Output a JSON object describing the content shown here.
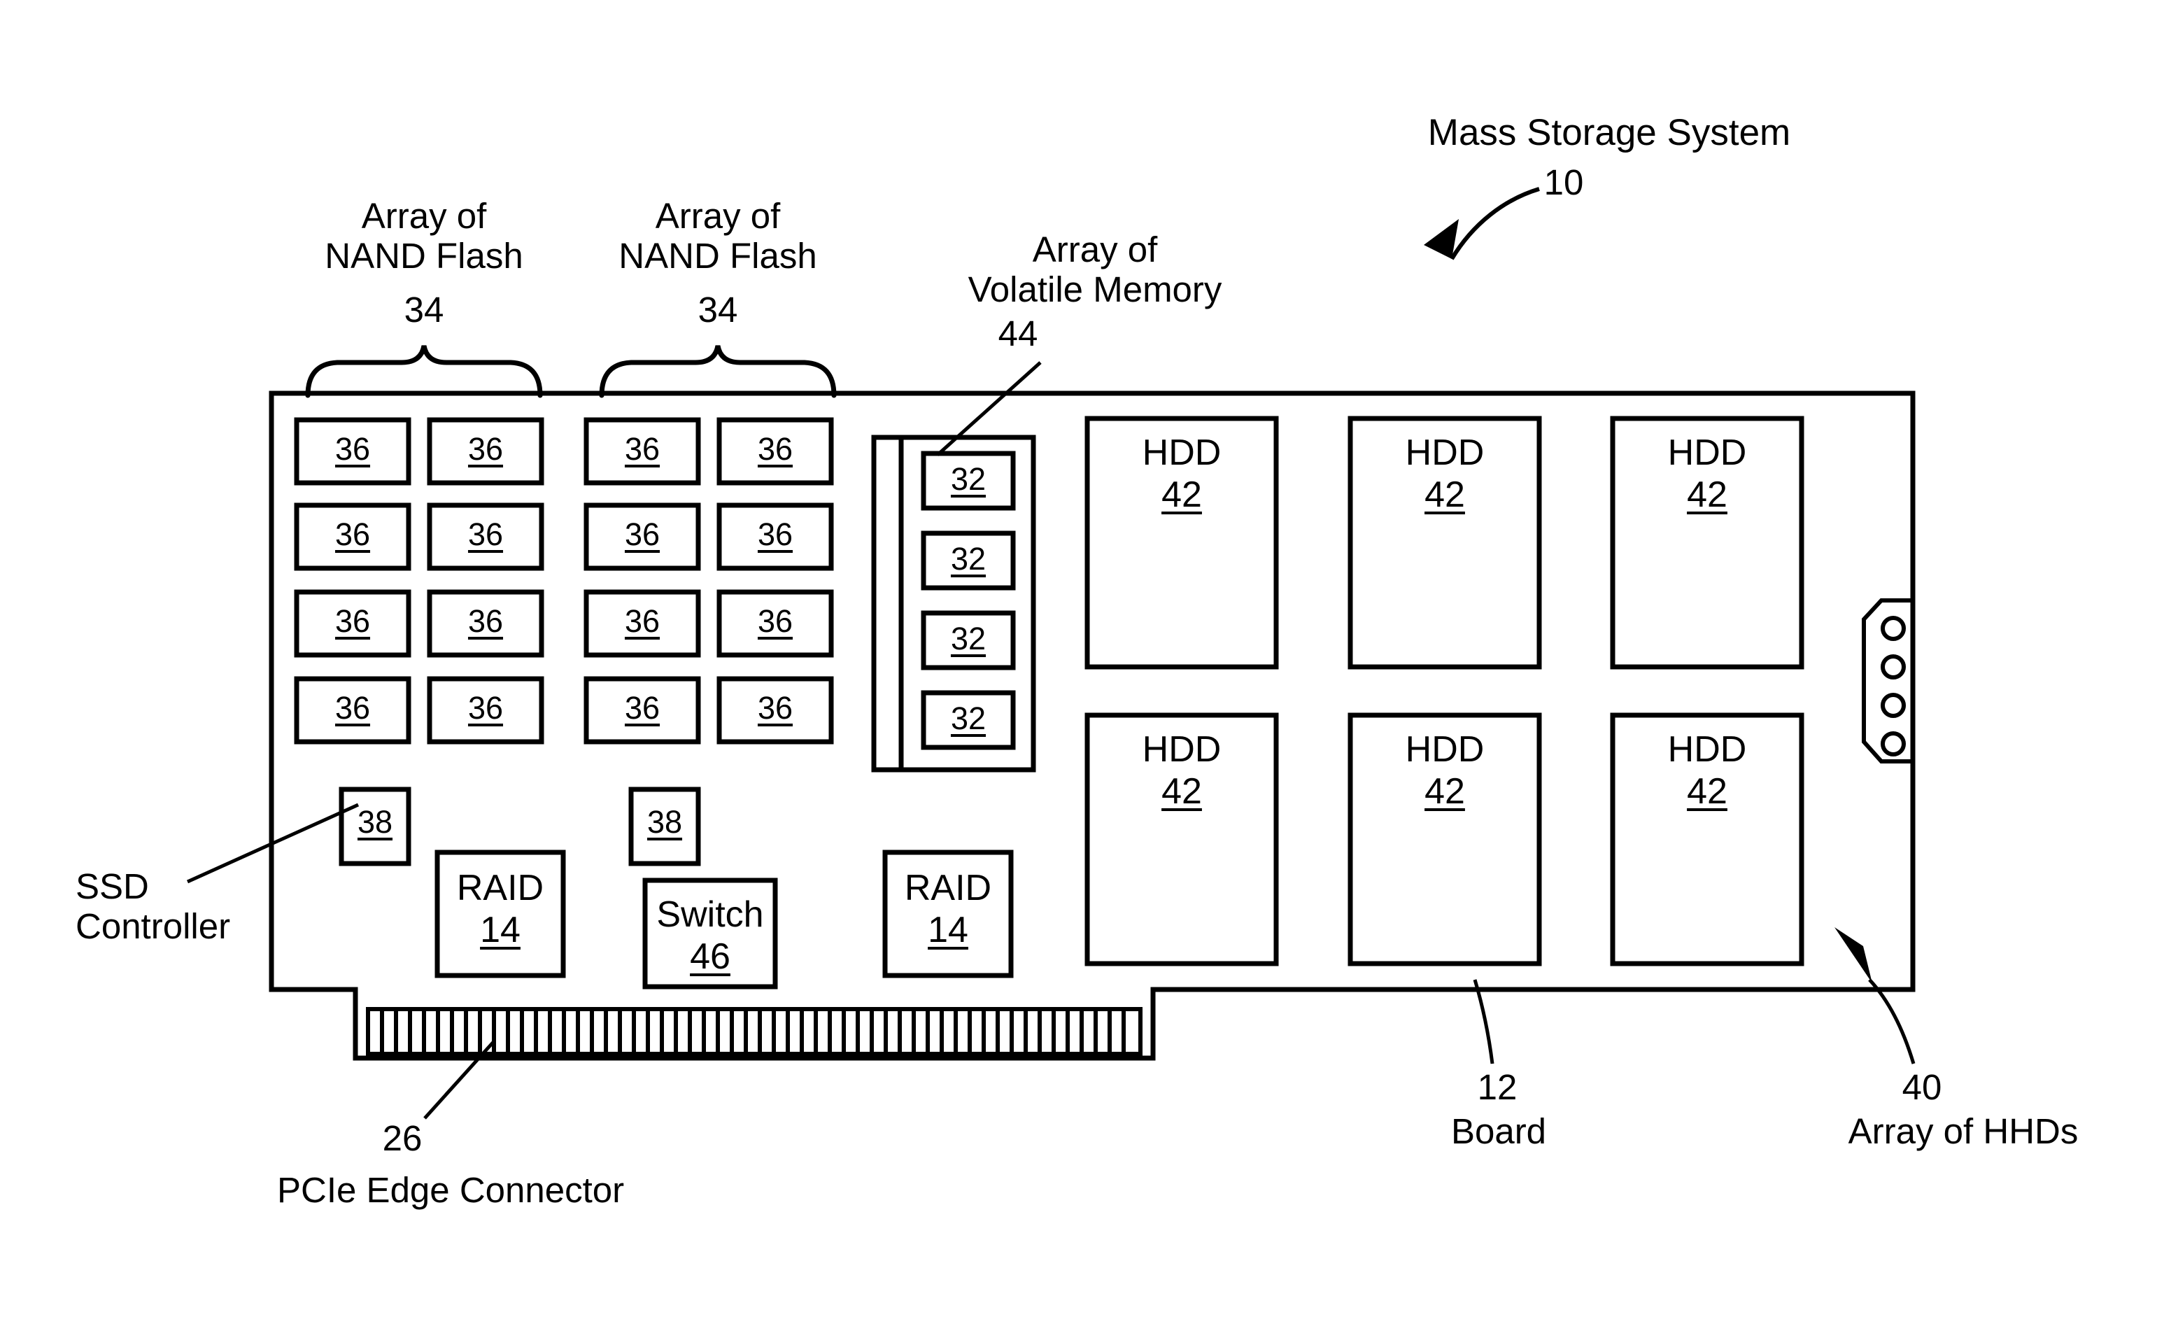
{
  "figure": {
    "title_label": "Mass Storage System",
    "title_ref": "10",
    "board_ref": "12",
    "board_label": "Board",
    "hdd_array_ref": "40",
    "hdd_array_label": "Array of HHDs",
    "pcie_ref": "26",
    "pcie_label": "PCIe Edge Connector",
    "ssd_controller_label": "SSD\nController",
    "nand_group_label": "Array of\nNAND Flash",
    "nand_group_ref": "34",
    "volatile_group_label": "Array of\nVolatile Memory",
    "volatile_group_ref": "44"
  },
  "nand_groups": [
    {
      "label": "Array of\nNAND Flash",
      "ref": "34",
      "chips": [
        {
          "ref": "36"
        },
        {
          "ref": "36"
        },
        {
          "ref": "36"
        },
        {
          "ref": "36"
        },
        {
          "ref": "36"
        },
        {
          "ref": "36"
        },
        {
          "ref": "36"
        },
        {
          "ref": "36"
        }
      ]
    },
    {
      "label": "Array of\nNAND Flash",
      "ref": "34",
      "chips": [
        {
          "ref": "36"
        },
        {
          "ref": "36"
        },
        {
          "ref": "36"
        },
        {
          "ref": "36"
        },
        {
          "ref": "36"
        },
        {
          "ref": "36"
        },
        {
          "ref": "36"
        },
        {
          "ref": "36"
        }
      ]
    }
  ],
  "volatile_memory": {
    "label": "Array of\nVolatile Memory",
    "ref": "44",
    "modules": [
      {
        "ref": "32"
      },
      {
        "ref": "32"
      },
      {
        "ref": "32"
      },
      {
        "ref": "32"
      }
    ]
  },
  "hdds": [
    {
      "name": "HDD",
      "ref": "42"
    },
    {
      "name": "HDD",
      "ref": "42"
    },
    {
      "name": "HDD",
      "ref": "42"
    },
    {
      "name": "HDD",
      "ref": "42"
    },
    {
      "name": "HDD",
      "ref": "42"
    },
    {
      "name": "HDD",
      "ref": "42"
    }
  ],
  "ssd_controllers": [
    {
      "ref": "38"
    },
    {
      "ref": "38"
    }
  ],
  "raid_controllers": [
    {
      "name": "RAID",
      "ref": "14"
    },
    {
      "name": "RAID",
      "ref": "14"
    }
  ],
  "switch": {
    "name": "Switch",
    "ref": "46"
  },
  "colors": {
    "line": "#000000",
    "background": "#ffffff"
  }
}
